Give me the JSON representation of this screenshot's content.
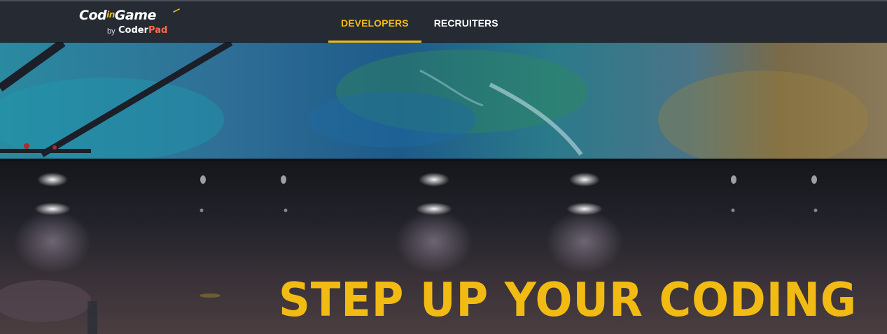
{
  "navbar": {
    "logo": {
      "brand_part1": "Cod",
      "brand_part2": "in",
      "brand_part3": "Game",
      "by_text": "by",
      "coderpad_part1": "Coder",
      "coderpad_part2": "Pad"
    },
    "tabs": [
      {
        "label": "DEVELOPERS",
        "active": true
      },
      {
        "label": "RECRUITERS",
        "active": false
      }
    ]
  },
  "hero": {
    "title": "STEP UP YOUR CODING"
  },
  "colors": {
    "accent": "#f2bb13",
    "navbar_bg": "#252a33",
    "coderpad_accent": "#ff6b4a"
  }
}
